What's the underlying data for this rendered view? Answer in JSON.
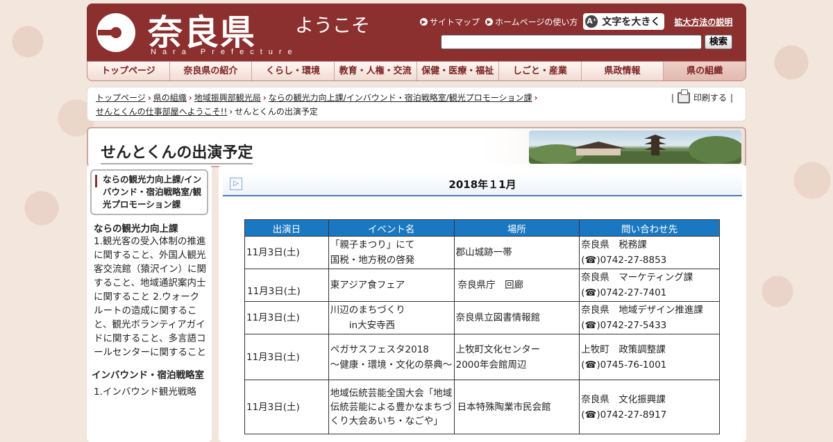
{
  "header": {
    "logo_title": "奈良県",
    "logo_sub": "Nara Prefecture",
    "welcome": "ようこそ",
    "links": {
      "sitemap": "サイトマップ",
      "howto": "ホームページの使い方"
    },
    "big_text_button": "文字を大きく",
    "expand_help": "拡大方法の説明",
    "search": {
      "value": "",
      "button": "検索"
    }
  },
  "gnav": [
    "トップページ",
    "奈良県の紹介",
    "くらし・環境",
    "教育・人権・交流",
    "保健・医療・福祉",
    "しごと・産業",
    "県政情報",
    "県の組織"
  ],
  "breadcrumb": {
    "items": [
      "トップページ",
      "県の組織",
      "地域振興部観光局",
      "ならの観光力向上課/インバウンド・宿泊戦略室/観光プロモーション課",
      "せんとくんの仕事部屋へようこそ!!"
    ],
    "current": "せんとくんの出演予定",
    "print": "印刷する"
  },
  "page_title": "せんとくんの出演予定",
  "sidebar": {
    "head": "ならの観光力向上課/インバウンド・宿泊戦略室/観光プロモーション課",
    "sec1_title": "ならの観光力向上課",
    "sec1_text": "1.観光客の受入体制の推進に関すること、外国人観光客交流館（猿沢イン）に関すること、地域通訳案内士に関すること 2.ウォークルートの造成に関すること、観光ボランティアガイドに関すること、多言語コールセンターに関すること",
    "sec2_title": "インバウンド・宿泊戦略室",
    "sec2_text": "1.インバウンド観光戦略"
  },
  "main": {
    "month_title": "2018年１1月",
    "table": {
      "headers": [
        "出演日",
        "イベント名",
        "場所",
        "問い合わせ先"
      ],
      "rows": [
        {
          "date": "11月3日(土)",
          "event": [
            "「親子まつり」にて",
            "国税・地方税の啓発"
          ],
          "place": [
            "郡山城跡一帯"
          ],
          "contact": "奈良県　税務課",
          "tel": "(☎)0742-27-8853"
        },
        {
          "date": "11月3日(土)",
          "event": [
            "東アジア食フェア"
          ],
          "place": [
            "奈良県庁　回廊"
          ],
          "contact": "奈良県　マーケティング課",
          "tel": "(☎)0742-27-7401"
        },
        {
          "date": "11月3日(土)",
          "event": [
            "川辺のまちづくり",
            "　　in大安寺西"
          ],
          "place": [
            "奈良県立図書情報館"
          ],
          "contact": "奈良県　地域デザイン推進課",
          "tel": "(☎)0742-27-5433"
        },
        {
          "date": "11月3日(土)",
          "event": [
            "ペガサスフェスタ2018",
            "～健康・環境・文化の祭典～"
          ],
          "place": [
            "上牧町文化センター",
            "2000年会館周辺"
          ],
          "contact": "上牧町　政策調整課",
          "tel": "(☎)0745-76-1001"
        },
        {
          "date": "11月3日(土)",
          "event": [
            "地域伝統芸能全国大会「地域伝統芸能による豊かなまちづくり大会あいち・なごや」"
          ],
          "place": [
            "日本特殊陶業市民会館"
          ],
          "contact": "奈良県　文化振興課",
          "tel": "(☎)0742-27-8917"
        }
      ]
    }
  },
  "colors": {
    "header_bg": "#8c2f2f",
    "table_head": "#1a78c2"
  }
}
